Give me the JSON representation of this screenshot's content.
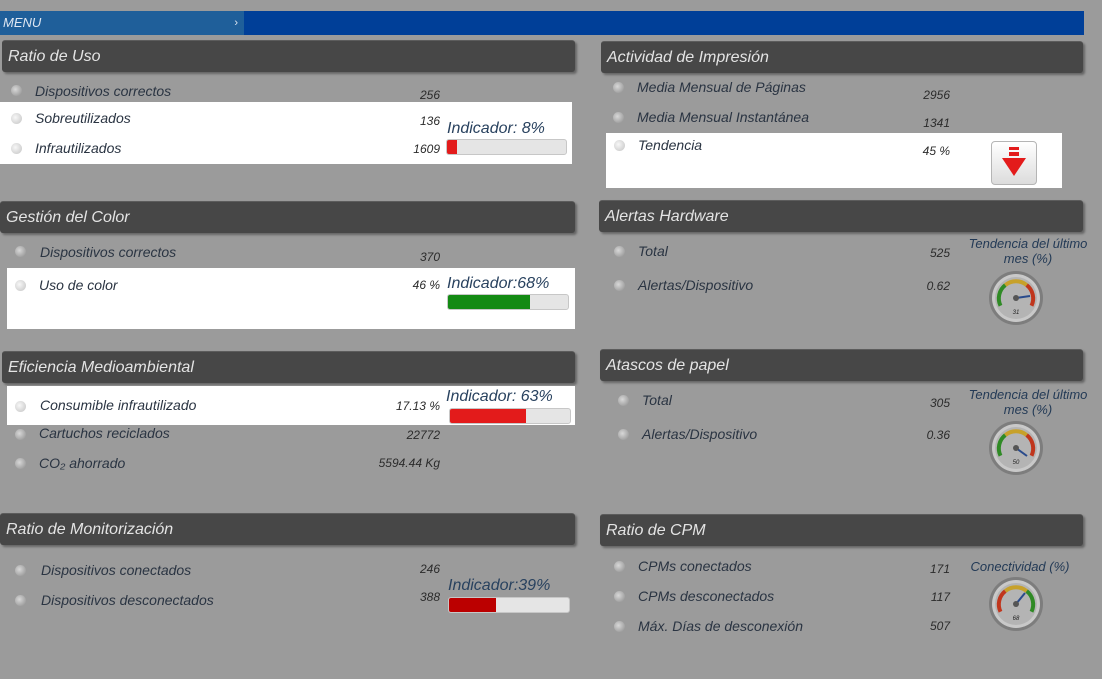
{
  "menu": {
    "label": "MENU",
    "chevron": "›"
  },
  "ratio_uso": {
    "title": "Ratio de Uso",
    "rows": [
      {
        "label": "Dispositivos correctos",
        "value": "256"
      },
      {
        "label": "Sobreutilizados",
        "value": "136"
      },
      {
        "label": "Infrautilizados",
        "value": "1609"
      }
    ],
    "indicator_label": "Indicador: 8%",
    "indicator_percent": 8,
    "indicator_color": "#e31b1b"
  },
  "gestion_color": {
    "title": "Gestión del Color",
    "rows": [
      {
        "label": "Dispositivos correctos",
        "value": "370"
      },
      {
        "label": "Uso de color",
        "value": "46 %"
      }
    ],
    "indicator_label": "Indicador:68%",
    "indicator_percent": 68,
    "indicator_color": "#138a13"
  },
  "eficiencia": {
    "title": "Eficiencia Medioambiental",
    "rows": [
      {
        "label": "Consumible infrautilizado",
        "value": "17.13 %"
      },
      {
        "label": "Cartuchos reciclados",
        "value": "22772"
      },
      {
        "label": "CO₂ ahorrado",
        "value": "5594.44 Kg"
      }
    ],
    "indicator_label": "Indicador: 63%",
    "indicator_percent": 63,
    "indicator_color": "#e31b1b"
  },
  "monitorizacion": {
    "title": "Ratio de Monitorización",
    "rows": [
      {
        "label": "Dispositivos conectados",
        "value": "246"
      },
      {
        "label": "Dispositivos desconectados",
        "value": "388"
      }
    ],
    "indicator_label": "Indicador:39%",
    "indicator_percent": 39,
    "indicator_color": "#bb0000"
  },
  "impresion": {
    "title": "Actividad de Impresión",
    "rows": [
      {
        "label": "Media Mensual de Páginas",
        "value": "2956"
      },
      {
        "label": "Media Mensual Instantánea",
        "value": "1341"
      },
      {
        "label": "Tendencia",
        "value": "45 %"
      }
    ],
    "trend_icon": "arrow-down-icon",
    "trend_color": "#e31b1b"
  },
  "alertas": {
    "title": "Alertas Hardware",
    "rows": [
      {
        "label": "Total",
        "value": "525"
      },
      {
        "label": "Alertas/Dispositivo",
        "value": "0.62"
      }
    ],
    "gauge_title": "Tendencia del último mes (%)",
    "gauge_value": "31"
  },
  "atascos": {
    "title": "Atascos de papel",
    "rows": [
      {
        "label": "Total",
        "value": "305"
      },
      {
        "label": "Alertas/Dispositivo",
        "value": "0.36"
      }
    ],
    "gauge_title": "Tendencia del último mes (%)",
    "gauge_value": "50"
  },
  "cpm": {
    "title": "Ratio de CPM",
    "rows": [
      {
        "label": "CPMs conectados",
        "value": "171"
      },
      {
        "label": "CPMs desconectados",
        "value": "117"
      },
      {
        "label": "Máx. Días de desconexión",
        "value": "507"
      }
    ],
    "gauge_title": "Conectividad (%)",
    "gauge_value": "68"
  }
}
